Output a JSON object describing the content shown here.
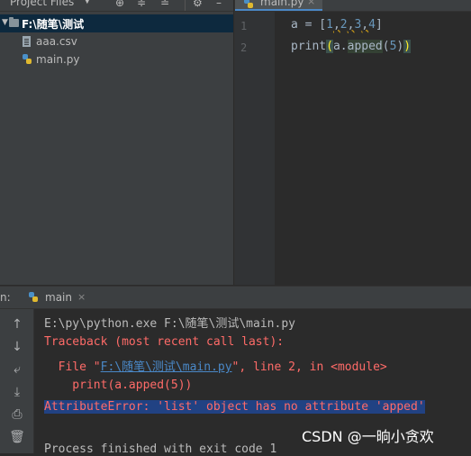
{
  "project_panel": {
    "title": "Project Files",
    "root_label": "F:\\随笔\\测试",
    "files": [
      {
        "name": "aaa.csv",
        "icon": "csv-file-icon"
      },
      {
        "name": "main.py",
        "icon": "python-file-icon"
      }
    ]
  },
  "editor": {
    "tab_label": "main.py",
    "close_glyph": "×",
    "line_numbers": [
      "1",
      "2"
    ]
  },
  "run": {
    "label": "n:",
    "tab_label": "main",
    "close_glyph": "×"
  },
  "console": {
    "command": "E:\\py\\python.exe F:\\随笔\\测试\\main.py",
    "traceback_header": "Traceback (most recent call last):",
    "file_prefix": "  File \"",
    "file_link": "F:\\随笔\\测试\\main.py",
    "file_suffix": "\", line 2, in <module>",
    "code_line": "    print(a.apped(5))",
    "error": "AttributeError: 'list' object has no attribute 'apped'",
    "finished": "Process finished with exit code 1"
  },
  "watermark": "CSDN @一晌小贪欢",
  "colors": {
    "background": "#2b2b2b",
    "panel": "#3c3f41",
    "selection": "#0d293e",
    "error_text": "#ff6b68",
    "link": "#4a88c7",
    "number": "#6897bb"
  }
}
